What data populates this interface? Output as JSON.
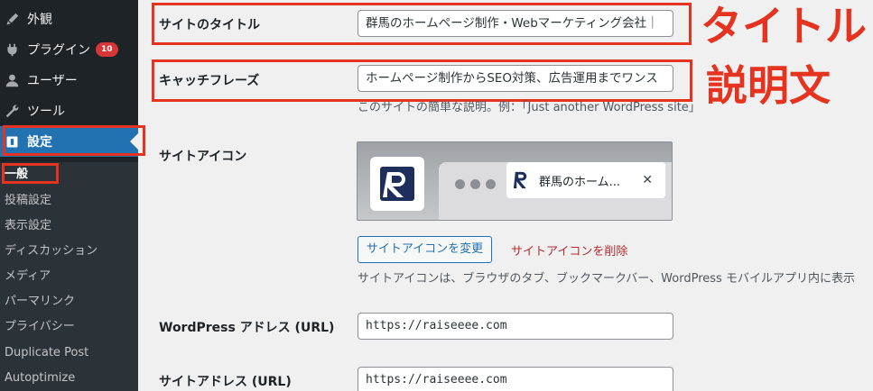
{
  "sidebar": {
    "items": [
      {
        "label": "外観",
        "icon": "appearance-icon"
      },
      {
        "label": "プラグイン",
        "icon": "plugins-icon",
        "badge": "10"
      },
      {
        "label": "ユーザー",
        "icon": "users-icon"
      },
      {
        "label": "ツール",
        "icon": "tools-icon"
      },
      {
        "label": "設定",
        "icon": "settings-icon"
      }
    ],
    "submenu": [
      "一般",
      "投稿設定",
      "表示設定",
      "ディスカッション",
      "メディア",
      "パーマリンク",
      "プライバシー",
      "Duplicate Post",
      "Autoptimize"
    ]
  },
  "form": {
    "site_title_label": "サイトのタイトル",
    "site_title_value": "群馬のホームページ制作・Webマーケティング会社｜",
    "tagline_label": "キャッチフレーズ",
    "tagline_value": "ホームページ制作からSEO対策、広告運用までワンス",
    "tagline_desc": "このサイトの簡単な説明。例：「Just another WordPress site」",
    "site_icon_label": "サイトアイコン",
    "preview_tab_text": "群馬のホーム...",
    "preview_close": "✕",
    "change_icon_button": "サイトアイコンを変更",
    "remove_icon_link": "サイトアイコンを削除",
    "site_icon_desc": "サイトアイコンは、ブラウザのタブ、ブックマークバー、WordPress モバイルアプリ内に表示",
    "wp_address_label": "WordPress アドレス (URL)",
    "wp_address_value": "https://raiseeee.com",
    "site_address_label": "サイトアドレス (URL)",
    "site_address_value": "https://raiseeee.com"
  },
  "annotations": {
    "title": "タイトル",
    "description": "説明文"
  },
  "colors": {
    "annotation_red": "#e5331f",
    "sidebar_bg": "#1d2327",
    "active_blue": "#2271b1"
  }
}
